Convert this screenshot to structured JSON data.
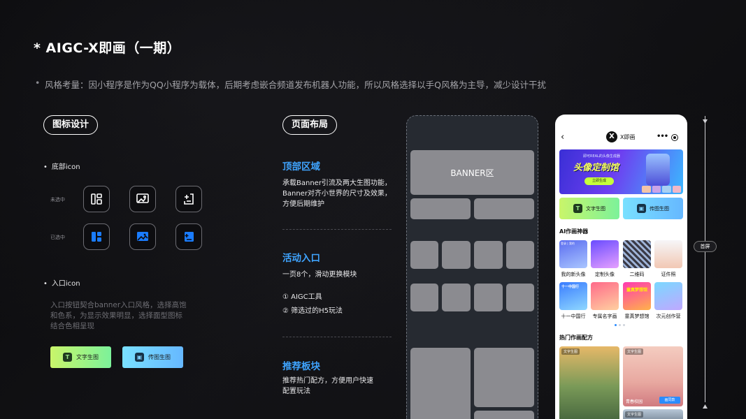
{
  "title": "* AIGC-X即画（一期）",
  "subtitle": "风格考量：因小程序是作为QQ小程序为载体，后期考虑嵌合频道发布机器人功能，所以风格选择以手Q风格为主导，减少设计干扰",
  "icon_design": {
    "pill": "图标设计",
    "bottom_icon_label": "底部icon",
    "unselected_label": "未选中",
    "selected_label": "已选中",
    "entry_icon_label": "入口icon",
    "entry_desc": "入口按钮契合banner入口风格，选择高饱和色系，为显示效果明显，选择面型图标结合色相呈现",
    "btn_text_to_image": "文字生图",
    "btn_image_to_image": "传图生图",
    "colors": {
      "selected_blue": "#1a7cff",
      "outline": "#ffffff",
      "text_btn_gradient": [
        "#c9f56a",
        "#7cf29a"
      ],
      "image_btn_gradient": [
        "#79e0ff",
        "#66b8ff"
      ]
    }
  },
  "layout": {
    "pill": "页面布局",
    "top_title": "顶部区域",
    "top_desc": "承载Banner引流及两大生图功能，Banner对齐小世界的尺寸及效果，方便后期维护",
    "activity_title": "活动入口",
    "activity_desc": "一页8个，滑动更换模块",
    "activity_item1": "① AIGC工具",
    "activity_item2": "② 筛选过的H5玩法",
    "recommend_title": "推荐板块",
    "recommend_desc": "推荐热门配方，方便用户快速配置玩法",
    "accent": "#3fa4ff"
  },
  "wireframe": {
    "banner_label": "BANNER区"
  },
  "phone": {
    "back_icon": "back-arrow-icon",
    "app_name": "X即画",
    "more_icon": "more-dots-icon",
    "target_icon": "target-icon",
    "banner_small": "即可REAL的头像生成器",
    "banner_big": "头像定制馆",
    "banner_cta": "立即生成",
    "btn_text_to_image": "文字生图",
    "btn_image_to_image": "传图生图",
    "ai_section": "AI作画神器",
    "tools": [
      {
        "label": "我的新头像",
        "tag": "登录 | 我的"
      },
      {
        "label": "定制头像",
        "tag": ""
      },
      {
        "label": "二维码",
        "tag": ""
      },
      {
        "label": "证件照",
        "tag": ""
      },
      {
        "label": "十一中国行",
        "tag": "十一中国行"
      },
      {
        "label": "专属名字画",
        "tag": ""
      },
      {
        "label": "童真梦想馆",
        "tag": "童真梦想馆"
      },
      {
        "label": "次元创作营",
        "tag": ""
      }
    ],
    "hot_section": "热门作画配方",
    "recipes": [
      {
        "tag": "文字生图",
        "caption": ""
      },
      {
        "tag": "文字生图",
        "caption": "青春校园",
        "badge": "画同款"
      },
      {
        "tag": "文字生图",
        "caption": ""
      }
    ]
  },
  "ruler": {
    "label": "首屏"
  }
}
